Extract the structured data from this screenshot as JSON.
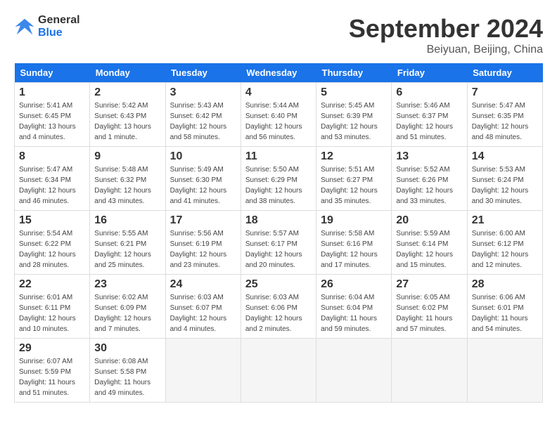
{
  "header": {
    "logo_line1": "General",
    "logo_line2": "Blue",
    "month_year": "September 2024",
    "location": "Beiyuan, Beijing, China"
  },
  "days_of_week": [
    "Sunday",
    "Monday",
    "Tuesday",
    "Wednesday",
    "Thursday",
    "Friday",
    "Saturday"
  ],
  "weeks": [
    [
      {
        "day": "1",
        "info": "Sunrise: 5:41 AM\nSunset: 6:45 PM\nDaylight: 13 hours\nand 4 minutes."
      },
      {
        "day": "2",
        "info": "Sunrise: 5:42 AM\nSunset: 6:43 PM\nDaylight: 13 hours\nand 1 minute."
      },
      {
        "day": "3",
        "info": "Sunrise: 5:43 AM\nSunset: 6:42 PM\nDaylight: 12 hours\nand 58 minutes."
      },
      {
        "day": "4",
        "info": "Sunrise: 5:44 AM\nSunset: 6:40 PM\nDaylight: 12 hours\nand 56 minutes."
      },
      {
        "day": "5",
        "info": "Sunrise: 5:45 AM\nSunset: 6:39 PM\nDaylight: 12 hours\nand 53 minutes."
      },
      {
        "day": "6",
        "info": "Sunrise: 5:46 AM\nSunset: 6:37 PM\nDaylight: 12 hours\nand 51 minutes."
      },
      {
        "day": "7",
        "info": "Sunrise: 5:47 AM\nSunset: 6:35 PM\nDaylight: 12 hours\nand 48 minutes."
      }
    ],
    [
      {
        "day": "8",
        "info": "Sunrise: 5:47 AM\nSunset: 6:34 PM\nDaylight: 12 hours\nand 46 minutes."
      },
      {
        "day": "9",
        "info": "Sunrise: 5:48 AM\nSunset: 6:32 PM\nDaylight: 12 hours\nand 43 minutes."
      },
      {
        "day": "10",
        "info": "Sunrise: 5:49 AM\nSunset: 6:30 PM\nDaylight: 12 hours\nand 41 minutes."
      },
      {
        "day": "11",
        "info": "Sunrise: 5:50 AM\nSunset: 6:29 PM\nDaylight: 12 hours\nand 38 minutes."
      },
      {
        "day": "12",
        "info": "Sunrise: 5:51 AM\nSunset: 6:27 PM\nDaylight: 12 hours\nand 35 minutes."
      },
      {
        "day": "13",
        "info": "Sunrise: 5:52 AM\nSunset: 6:26 PM\nDaylight: 12 hours\nand 33 minutes."
      },
      {
        "day": "14",
        "info": "Sunrise: 5:53 AM\nSunset: 6:24 PM\nDaylight: 12 hours\nand 30 minutes."
      }
    ],
    [
      {
        "day": "15",
        "info": "Sunrise: 5:54 AM\nSunset: 6:22 PM\nDaylight: 12 hours\nand 28 minutes."
      },
      {
        "day": "16",
        "info": "Sunrise: 5:55 AM\nSunset: 6:21 PM\nDaylight: 12 hours\nand 25 minutes."
      },
      {
        "day": "17",
        "info": "Sunrise: 5:56 AM\nSunset: 6:19 PM\nDaylight: 12 hours\nand 23 minutes."
      },
      {
        "day": "18",
        "info": "Sunrise: 5:57 AM\nSunset: 6:17 PM\nDaylight: 12 hours\nand 20 minutes."
      },
      {
        "day": "19",
        "info": "Sunrise: 5:58 AM\nSunset: 6:16 PM\nDaylight: 12 hours\nand 17 minutes."
      },
      {
        "day": "20",
        "info": "Sunrise: 5:59 AM\nSunset: 6:14 PM\nDaylight: 12 hours\nand 15 minutes."
      },
      {
        "day": "21",
        "info": "Sunrise: 6:00 AM\nSunset: 6:12 PM\nDaylight: 12 hours\nand 12 minutes."
      }
    ],
    [
      {
        "day": "22",
        "info": "Sunrise: 6:01 AM\nSunset: 6:11 PM\nDaylight: 12 hours\nand 10 minutes."
      },
      {
        "day": "23",
        "info": "Sunrise: 6:02 AM\nSunset: 6:09 PM\nDaylight: 12 hours\nand 7 minutes."
      },
      {
        "day": "24",
        "info": "Sunrise: 6:03 AM\nSunset: 6:07 PM\nDaylight: 12 hours\nand 4 minutes."
      },
      {
        "day": "25",
        "info": "Sunrise: 6:03 AM\nSunset: 6:06 PM\nDaylight: 12 hours\nand 2 minutes."
      },
      {
        "day": "26",
        "info": "Sunrise: 6:04 AM\nSunset: 6:04 PM\nDaylight: 11 hours\nand 59 minutes."
      },
      {
        "day": "27",
        "info": "Sunrise: 6:05 AM\nSunset: 6:02 PM\nDaylight: 11 hours\nand 57 minutes."
      },
      {
        "day": "28",
        "info": "Sunrise: 6:06 AM\nSunset: 6:01 PM\nDaylight: 11 hours\nand 54 minutes."
      }
    ],
    [
      {
        "day": "29",
        "info": "Sunrise: 6:07 AM\nSunset: 5:59 PM\nDaylight: 11 hours\nand 51 minutes."
      },
      {
        "day": "30",
        "info": "Sunrise: 6:08 AM\nSunset: 5:58 PM\nDaylight: 11 hours\nand 49 minutes."
      },
      {
        "day": "",
        "info": ""
      },
      {
        "day": "",
        "info": ""
      },
      {
        "day": "",
        "info": ""
      },
      {
        "day": "",
        "info": ""
      },
      {
        "day": "",
        "info": ""
      }
    ]
  ]
}
